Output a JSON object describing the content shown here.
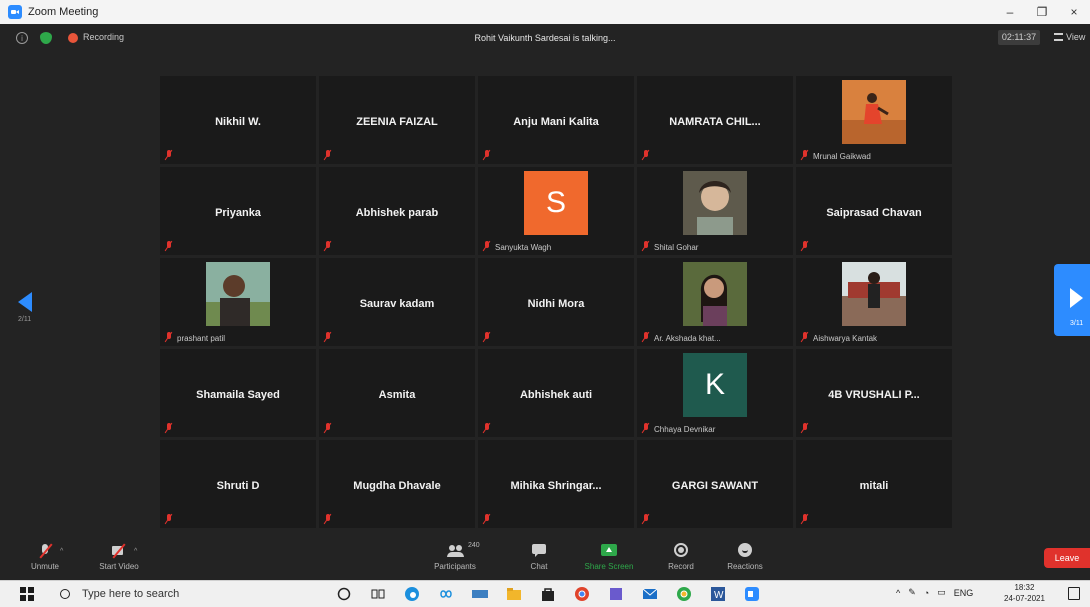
{
  "window": {
    "title": "Zoom Meeting",
    "minimize": "–",
    "restore": "❐",
    "close": "×"
  },
  "meeting_bar": {
    "recording_label": "Recording",
    "talking": "Rohit Vaikunth Sardesai is talking...",
    "timer": "02:11:37",
    "view_label": "View"
  },
  "pager": {
    "left_page": "2/11",
    "right_page": "3/11"
  },
  "participants": [
    {
      "name": "Nikhil W.",
      "label": "",
      "kind": "name"
    },
    {
      "name": "ZEENIA FAIZAL",
      "label": "",
      "kind": "name"
    },
    {
      "name": "Anju Mani Kalita",
      "label": "",
      "kind": "name"
    },
    {
      "name": "NAMRATA CHIL...",
      "label": "",
      "kind": "name"
    },
    {
      "name": "",
      "label": "Mrunal Gaikwad",
      "kind": "photo",
      "photo": "orange"
    },
    {
      "name": "Priyanka",
      "label": "",
      "kind": "name"
    },
    {
      "name": "Abhishek parab",
      "label": "",
      "kind": "name"
    },
    {
      "name": "S",
      "label": "Sanyukta Wagh",
      "kind": "letter",
      "color": "#f0692d"
    },
    {
      "name": "",
      "label": "Shital Gohar",
      "kind": "photo",
      "photo": "face"
    },
    {
      "name": "Saiprasad Chavan",
      "label": "",
      "kind": "name"
    },
    {
      "name": "",
      "label": "prashant patil",
      "kind": "photo",
      "photo": "man"
    },
    {
      "name": "Saurav kadam",
      "label": "",
      "kind": "name"
    },
    {
      "name": "Nidhi Mora",
      "label": "",
      "kind": "name"
    },
    {
      "name": "",
      "label": "Ar. Akshada khat...",
      "kind": "photo",
      "photo": "woman"
    },
    {
      "name": "",
      "label": "Aishwarya Kantak",
      "kind": "photo",
      "photo": "outdoor"
    },
    {
      "name": "Shamaila Sayed",
      "label": "",
      "kind": "name"
    },
    {
      "name": "Asmita",
      "label": "",
      "kind": "name"
    },
    {
      "name": "Abhishek auti",
      "label": "",
      "kind": "name"
    },
    {
      "name": "K",
      "label": "Chhaya Devnikar",
      "kind": "letter",
      "color": "#1f5a4e"
    },
    {
      "name": "4B VRUSHALI P...",
      "label": "",
      "kind": "name"
    },
    {
      "name": "Shruti D",
      "label": "",
      "kind": "name"
    },
    {
      "name": "Mugdha Dhavale",
      "label": "",
      "kind": "name"
    },
    {
      "name": "Mihika  Shringar...",
      "label": "",
      "kind": "name"
    },
    {
      "name": "GARGI SAWANT",
      "label": "",
      "kind": "name"
    },
    {
      "name": "mitali",
      "label": "",
      "kind": "name"
    }
  ],
  "toolbar": {
    "unmute": "Unmute",
    "start_video": "Start Video",
    "participants": "Participants",
    "participant_count": "240",
    "chat": "Chat",
    "share_screen": "Share Screen",
    "record": "Record",
    "reactions": "Reactions",
    "leave": "Leave"
  },
  "taskbar": {
    "search_placeholder": "Type here to search",
    "language": "ENG",
    "time": "18:32",
    "date": "24-07-2021"
  },
  "colors": {
    "meeting_bg": "#232323",
    "tile_bg": "#1a1a1a",
    "accent": "#2d8cff",
    "leave": "#e0322c",
    "share": "#2ea84a"
  }
}
